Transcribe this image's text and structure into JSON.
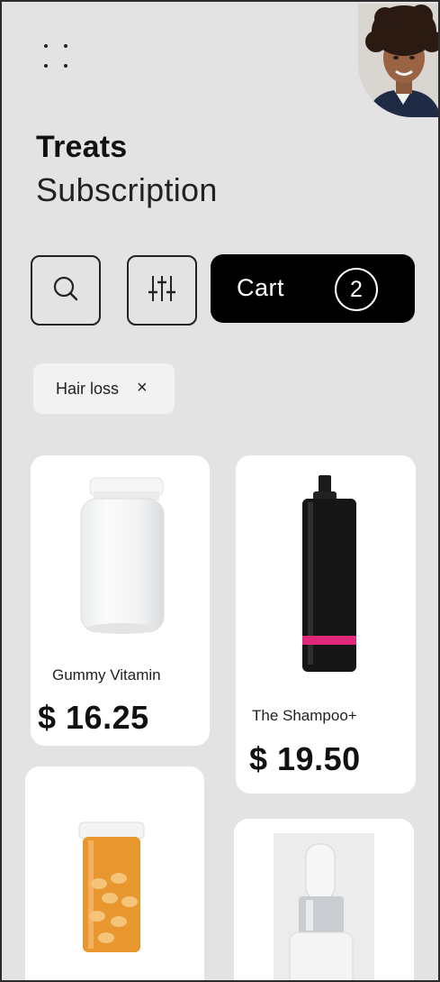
{
  "header": {
    "title": "Treats",
    "subtitle": "Subscription",
    "menu_icon": "dots-grid-icon",
    "avatar_icon": "user-avatar"
  },
  "toolbar": {
    "search_icon": "search-icon",
    "filter_icon": "sliders-icon",
    "cart_label": "Cart",
    "cart_count": "2"
  },
  "filters": {
    "chips": [
      {
        "label": "Hair loss",
        "remove": "×"
      }
    ]
  },
  "products": [
    {
      "name": "Gummy Vitamin",
      "price": "$ 16.25",
      "image": "clear-supplement-jar"
    },
    {
      "name": "The Shampoo+",
      "price": "$ 19.50",
      "image": "black-shampoo-bottle"
    },
    {
      "name": "",
      "price": "",
      "image": "orange-pill-bottle"
    },
    {
      "name": "",
      "price": "",
      "image": "dropper-serum-bottle"
    }
  ],
  "colors": {
    "background": "#e3e3e3",
    "card": "#ffffff",
    "accent_black": "#000000",
    "shampoo_band": "#e0287a",
    "pill_orange": "#e8962e"
  }
}
